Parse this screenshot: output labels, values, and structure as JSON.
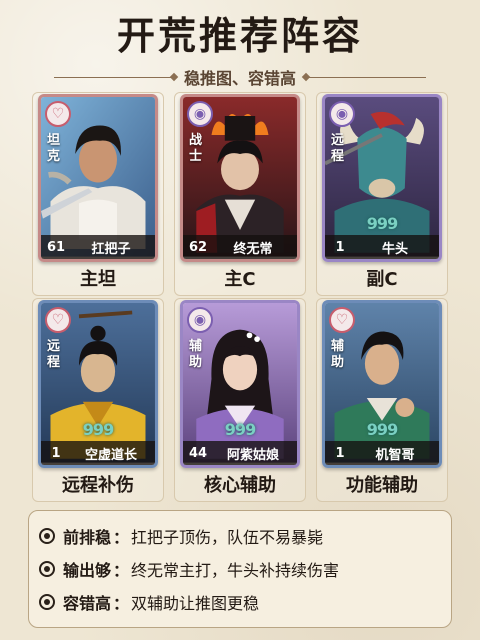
{
  "title": "开荒推荐阵容",
  "subtitle": "稳推图、容错高",
  "heroes": [
    {
      "role": "坦克",
      "level": "61",
      "name": "扛把子",
      "stars": "",
      "position_label": "主坦",
      "theme": "red"
    },
    {
      "role": "战士",
      "level": "62",
      "name": "终无常",
      "stars": "",
      "position_label": "主C",
      "theme": "red"
    },
    {
      "role": "远程",
      "level": "1",
      "name": "牛头",
      "stars": "999",
      "position_label": "副C",
      "theme": "purple"
    },
    {
      "role": "远程",
      "level": "1",
      "name": "空虚道长",
      "stars": "999",
      "position_label": "远程补伤",
      "theme": "blue"
    },
    {
      "role": "辅助",
      "level": "44",
      "name": "阿紫姑娘",
      "stars": "999",
      "position_label": "核心辅助",
      "theme": "purple"
    },
    {
      "role": "辅助",
      "level": "1",
      "name": "机智哥",
      "stars": "999",
      "position_label": "功能辅助",
      "theme": "blue"
    }
  ],
  "notes": [
    {
      "key": "前排稳",
      "text": "扛把子顶伤，队伍不易暴毙"
    },
    {
      "key": "输出够",
      "text": "终无常主打，牛头补持续伤害"
    },
    {
      "key": "容错高",
      "text": "双辅助让推图更稳"
    }
  ],
  "colors": {
    "background": "#eee6d3",
    "red_frame": "#c58a88",
    "purple_frame": "#9a86c5",
    "blue_frame": "#6d8cb8",
    "star": "#7ad0c2"
  }
}
